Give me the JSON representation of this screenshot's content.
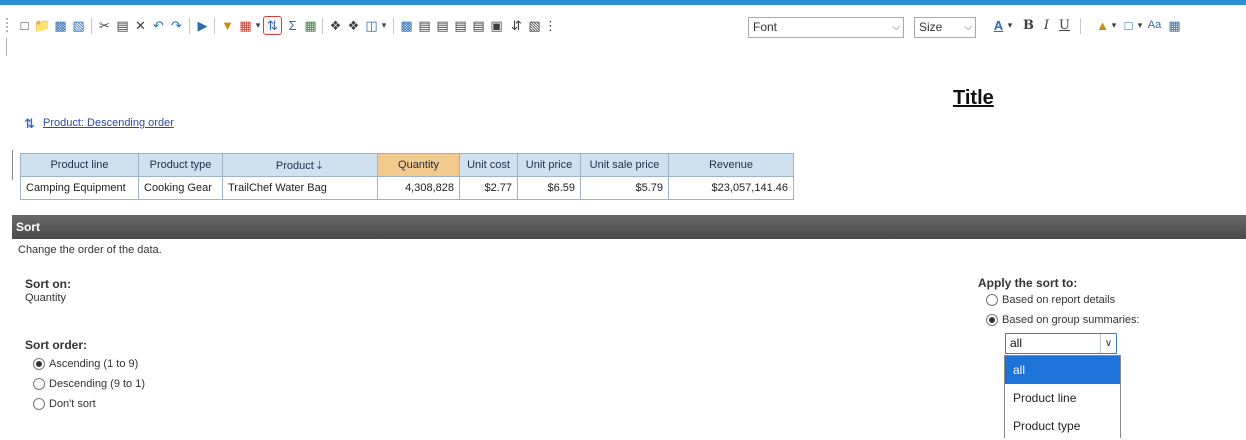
{
  "toolbar": {
    "icons": [
      "grip-icon",
      "new-icon",
      "open-icon",
      "save-icon",
      "save-as-icon",
      "cut-icon",
      "paste-icon",
      "delete-icon",
      "undo-icon",
      "redo-icon",
      "run-icon",
      "filter-icon",
      "suppress-icon",
      "sort-icon",
      "summarize-icon",
      "calculate-icon",
      "group-icon",
      "ungroup-icon",
      "pivot-icon",
      "chart-icon",
      "insert-table-icon",
      "insert-row-icon",
      "insert-column-icon",
      "insert-cell-icon",
      "insert-image-icon",
      "swap-icon",
      "header-icon",
      "grip-icon"
    ],
    "font_value": "Font",
    "size_value": "Size",
    "format_icons": [
      "font-color-icon",
      "bold-icon",
      "italic-icon",
      "underline-icon",
      "fill-color-icon",
      "border-icon",
      "style-icon",
      "table-style-icon"
    ]
  },
  "report": {
    "title": "Title",
    "sort_indicator": "Product: Descending order"
  },
  "table": {
    "headers": [
      "Product line",
      "Product type",
      "Product",
      "Quantity",
      "Unit cost",
      "Unit price",
      "Unit sale price",
      "Revenue"
    ],
    "product_sort_arrow": "⇣",
    "rows": [
      [
        "Camping Equipment",
        "Cooking Gear",
        "TrailChef Water Bag",
        "4,308,828",
        "$2.77",
        "$6.59",
        "$5.79",
        "$23,057,141.46"
      ]
    ]
  },
  "sort_panel": {
    "header": "Sort",
    "description": "Change the order of the data.",
    "sort_on_label": "Sort on:",
    "sort_on_value": "Quantity",
    "sort_order_label": "Sort order:",
    "order_options": [
      "Ascending (1 to 9)",
      "Descending (9 to 1)",
      "Don't sort"
    ],
    "order_selected": "Ascending (1 to 9)",
    "apply_label": "Apply the sort to:",
    "apply_options": [
      "Based on report details",
      "Based on group summaries:"
    ],
    "apply_selected": "Based on group summaries:",
    "group_dropdown": {
      "value": "all",
      "options": [
        "all",
        "Product line",
        "Product type"
      ],
      "highlighted": "all"
    }
  }
}
